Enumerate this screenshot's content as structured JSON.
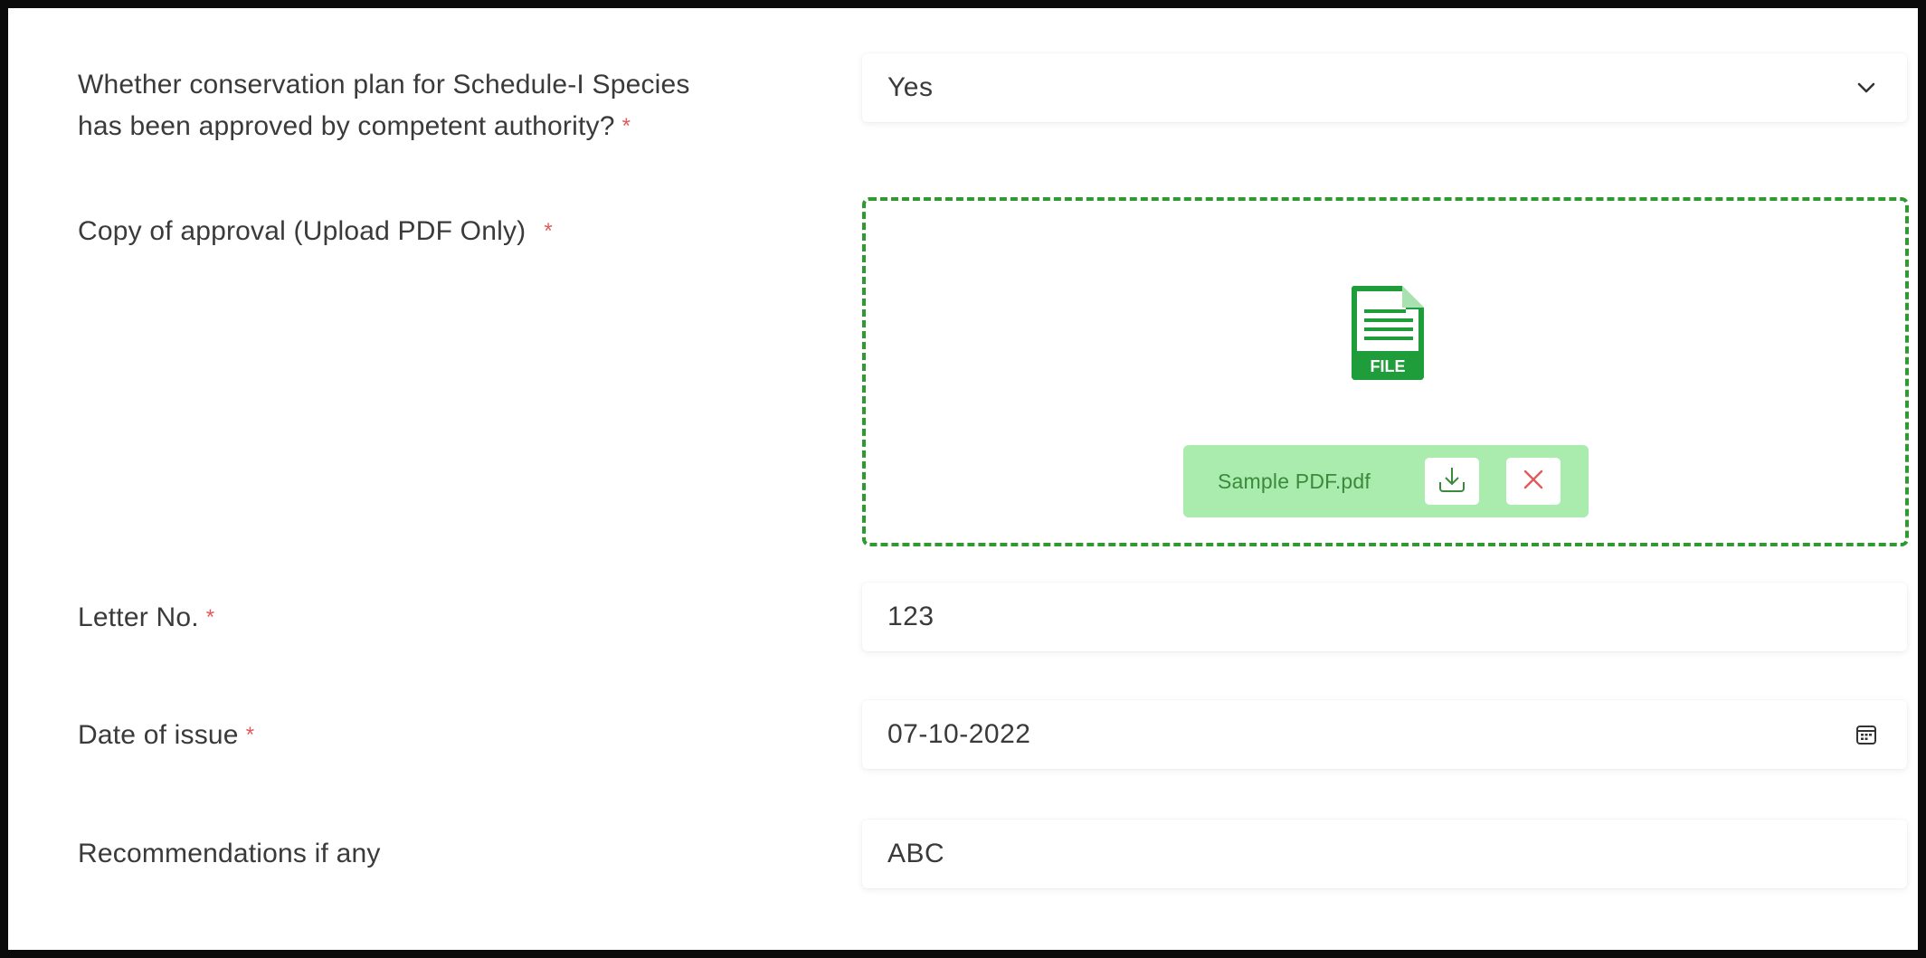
{
  "form": {
    "conservation_plan": {
      "label_line1": "Whether conservation plan for Schedule-I Species",
      "label_line2": "has been approved by competent authority?",
      "required_mark": "*",
      "selected_value": "Yes",
      "icon": "chevron-down-icon"
    },
    "approval_copy": {
      "label": "Copy of approval (Upload PDF Only)",
      "required_mark": "*",
      "file_icon": "file-icon",
      "file_icon_text": "FILE",
      "file_name": "Sample PDF.pdf",
      "download_icon": "download-icon",
      "remove_icon": "close-icon"
    },
    "letter_no": {
      "label": "Letter No.",
      "required_mark": "*",
      "value": "123"
    },
    "date_of_issue": {
      "label": "Date of issue",
      "required_mark": "*",
      "value": "07-10-2022",
      "icon": "calendar-icon"
    },
    "recommendations": {
      "label": "Recommendations if any",
      "value": "ABC"
    }
  },
  "colors": {
    "required": "#e05a5a",
    "upload_border": "#2f9a2f",
    "file_chip_bg": "#a9ecae",
    "file_chip_text": "#3b8a3b",
    "file_icon": "#1f9d3a",
    "remove_icon": "#e05a5a"
  }
}
